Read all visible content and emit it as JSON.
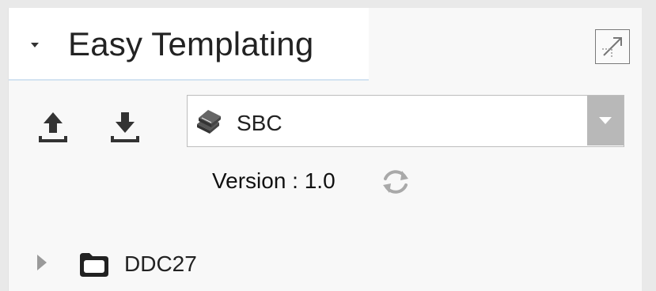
{
  "panel": {
    "title": "Easy Templating",
    "collapse_icon": "caret-down-icon",
    "maximize_icon": "maximize-icon"
  },
  "toolbar": {
    "upload_icon": "upload-icon",
    "download_icon": "download-icon",
    "template_select": {
      "icon": "books-icon",
      "value": "SBC"
    }
  },
  "version": {
    "text": "Version : 1.0",
    "refresh_icon": "refresh-icon"
  },
  "tree": {
    "items": [
      {
        "label": "DDC27",
        "icon": "folder-icon",
        "expanded": false
      }
    ]
  },
  "colors": {
    "tab_underline": "#d3e3f1",
    "dropdown_button": "#b8b8b8",
    "icon_dark": "#333333",
    "icon_light": "#a9a9a9"
  }
}
